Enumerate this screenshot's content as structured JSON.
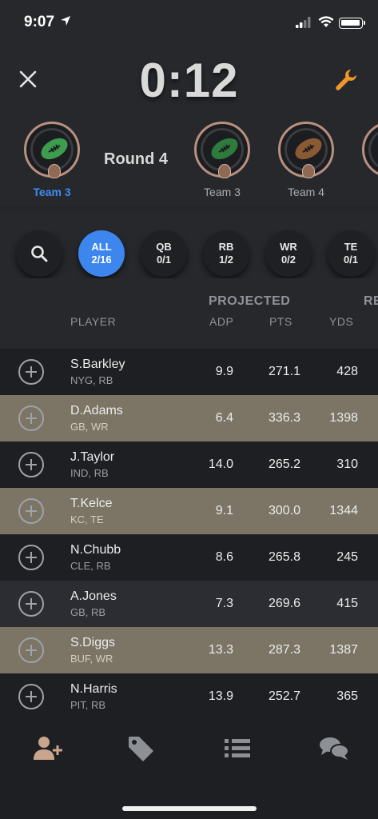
{
  "status_bar": {
    "time": "9:07"
  },
  "header": {
    "timer": "0:12"
  },
  "picks": {
    "round_label": "Round 4",
    "items": [
      {
        "label": "Team 3",
        "active": true,
        "ball_color": "#3e9c4f"
      },
      {
        "label": "Team 3",
        "active": false,
        "ball_color": "#2f7a3d"
      },
      {
        "label": "Team 4",
        "active": false,
        "ball_color": "#8a5a32"
      },
      {
        "label": "T",
        "active": false,
        "ball_color": "#8a5a32"
      }
    ]
  },
  "filters": [
    {
      "label": "ALL",
      "count": "2/16",
      "active": true
    },
    {
      "label": "QB",
      "count": "0/1",
      "active": false
    },
    {
      "label": "RB",
      "count": "1/2",
      "active": false
    },
    {
      "label": "WR",
      "count": "0/2",
      "active": false
    },
    {
      "label": "TE",
      "count": "0/1",
      "active": false
    }
  ],
  "columns": {
    "group_projected": "PROJECTED",
    "group_next": "RE",
    "player": "PLAYER",
    "adp": "ADP",
    "pts": "PTS",
    "yds": "YDS"
  },
  "players": [
    {
      "name": "S.Barkley",
      "team": "NYG, RB",
      "adp": "9.9",
      "pts": "271.1",
      "yds": "428",
      "style": "dark"
    },
    {
      "name": "D.Adams",
      "team": "GB, WR",
      "adp": "6.4",
      "pts": "336.3",
      "yds": "1398",
      "style": "drafted"
    },
    {
      "name": "J.Taylor",
      "team": "IND, RB",
      "adp": "14.0",
      "pts": "265.2",
      "yds": "310",
      "style": "dark"
    },
    {
      "name": "T.Kelce",
      "team": "KC, TE",
      "adp": "9.1",
      "pts": "300.0",
      "yds": "1344",
      "style": "drafted"
    },
    {
      "name": "N.Chubb",
      "team": "CLE, RB",
      "adp": "8.6",
      "pts": "265.8",
      "yds": "245",
      "style": "dark"
    },
    {
      "name": "A.Jones",
      "team": "GB, RB",
      "adp": "7.3",
      "pts": "269.6",
      "yds": "415",
      "style": "alt"
    },
    {
      "name": "S.Diggs",
      "team": "BUF, WR",
      "adp": "13.3",
      "pts": "287.3",
      "yds": "1387",
      "style": "drafted"
    },
    {
      "name": "N.Harris",
      "team": "PIT, RB",
      "adp": "13.9",
      "pts": "252.7",
      "yds": "365",
      "style": "dark"
    }
  ],
  "nav": [
    {
      "icon": "add-user-icon",
      "active": true
    },
    {
      "icon": "tag-icon",
      "active": false
    },
    {
      "icon": "list-icon",
      "active": false
    },
    {
      "icon": "chat-icon",
      "active": false
    }
  ],
  "colors": {
    "accent_blue": "#3d86ee",
    "wrench_orange": "#f0962a",
    "drafted_row": "#7c7566",
    "nav_active": "#c9a58e"
  }
}
